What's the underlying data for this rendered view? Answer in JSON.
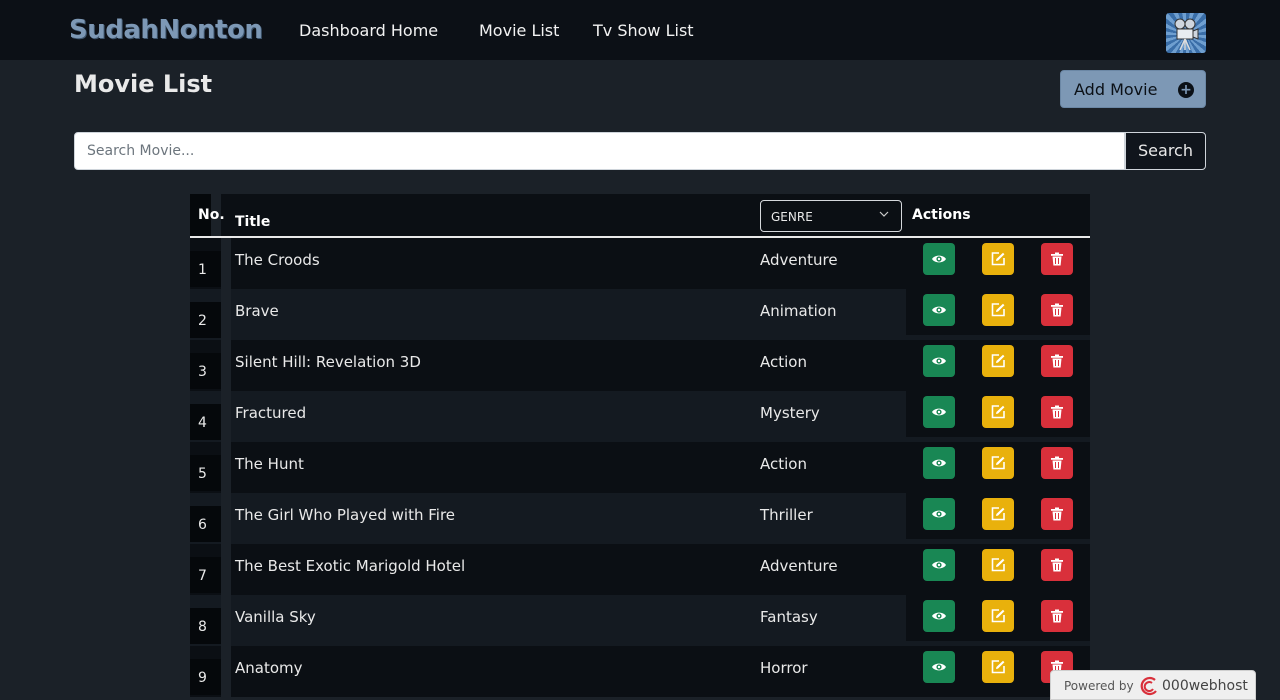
{
  "navbar": {
    "brand": "SudahNonton",
    "links": [
      "Dashboard Home",
      "Movie List",
      "Tv Show List"
    ]
  },
  "page": {
    "title": "Movie List",
    "add_button": "Add Movie"
  },
  "search": {
    "placeholder": "Search Movie...",
    "button": "Search"
  },
  "table": {
    "headers": {
      "no": "No.",
      "title": "Title",
      "genre_select": "GENRE",
      "actions": "Actions"
    },
    "rows": [
      {
        "no": "1",
        "title": "The Croods",
        "genre": "Adventure"
      },
      {
        "no": "2",
        "title": "Brave",
        "genre": "Animation"
      },
      {
        "no": "3",
        "title": "Silent Hill: Revelation 3D",
        "genre": "Action"
      },
      {
        "no": "4",
        "title": "Fractured",
        "genre": "Mystery"
      },
      {
        "no": "5",
        "title": "The Hunt",
        "genre": "Action"
      },
      {
        "no": "6",
        "title": "The Girl Who Played with Fire",
        "genre": "Thriller"
      },
      {
        "no": "7",
        "title": "The Best Exotic Marigold Hotel",
        "genre": "Adventure"
      },
      {
        "no": "8",
        "title": "Vanilla Sky",
        "genre": "Fantasy"
      },
      {
        "no": "9",
        "title": "Anatomy",
        "genre": "Horror"
      }
    ]
  },
  "footer_badge": {
    "powered_by": "Powered by",
    "host": "000webhost"
  },
  "colors": {
    "background": "#1b2128",
    "navbar": "#0c1016",
    "brand": "#7d98b5",
    "view": "#198754",
    "edit": "#e9b10c",
    "delete": "#d9303b"
  },
  "icons": {
    "view": "eye-icon",
    "edit": "edit-icon",
    "delete": "trash-icon",
    "add": "plus-circle-icon",
    "genre": "chevron-down-icon"
  }
}
